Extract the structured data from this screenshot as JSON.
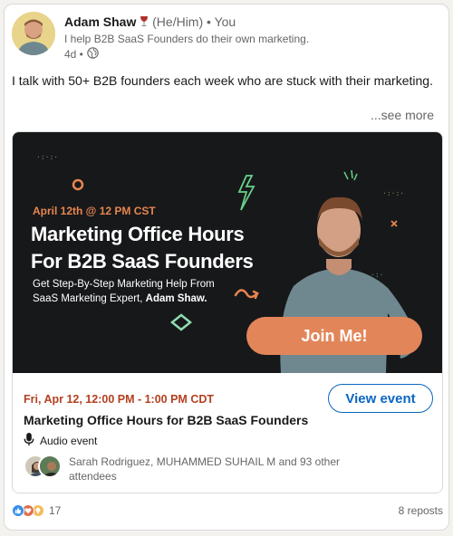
{
  "post": {
    "author": {
      "name": "Adam Shaw",
      "pronouns": "(He/Him)",
      "badge_icon": "wine-glass-icon",
      "separator": "•",
      "relation": "You",
      "headline": "I help B2B SaaS Founders do their own marketing.",
      "time": "4d •",
      "visibility_icon": "globe-icon"
    },
    "text": "I talk with 50+ B2B founders each week who are stuck with their marketing.",
    "see_more": "...see more"
  },
  "event": {
    "banner": {
      "date": "April 12th @ 12 PM CST",
      "title_line1": "Marketing Office Hours",
      "title_line2": "For B2B SaaS Founders",
      "sub_line1": "Get Step-By-Step Marketing Help From",
      "sub_line2": "SaaS Marketing Expert,",
      "sub_name": "Adam Shaw.",
      "cta": "Join Me!"
    },
    "date": "Fri, Apr 12, 12:00 PM - 1:00 PM CDT",
    "title": "Marketing Office Hours for B2B SaaS Founders",
    "type_icon": "microphone-icon",
    "type": "Audio event",
    "attendees": "Sarah Rodriguez, MUHAMMED SUHAIL M and 93 other attendees",
    "view_button": "View event"
  },
  "social": {
    "reaction_icons": [
      "like-icon",
      "love-icon",
      "insightful-icon"
    ],
    "reaction_count": "17",
    "reposts": "8 reposts"
  },
  "colors": {
    "accent_orange": "#e2865a",
    "link_blue": "#0a66c2",
    "event_date_red": "#b24020",
    "banner_bg": "#17181a"
  }
}
